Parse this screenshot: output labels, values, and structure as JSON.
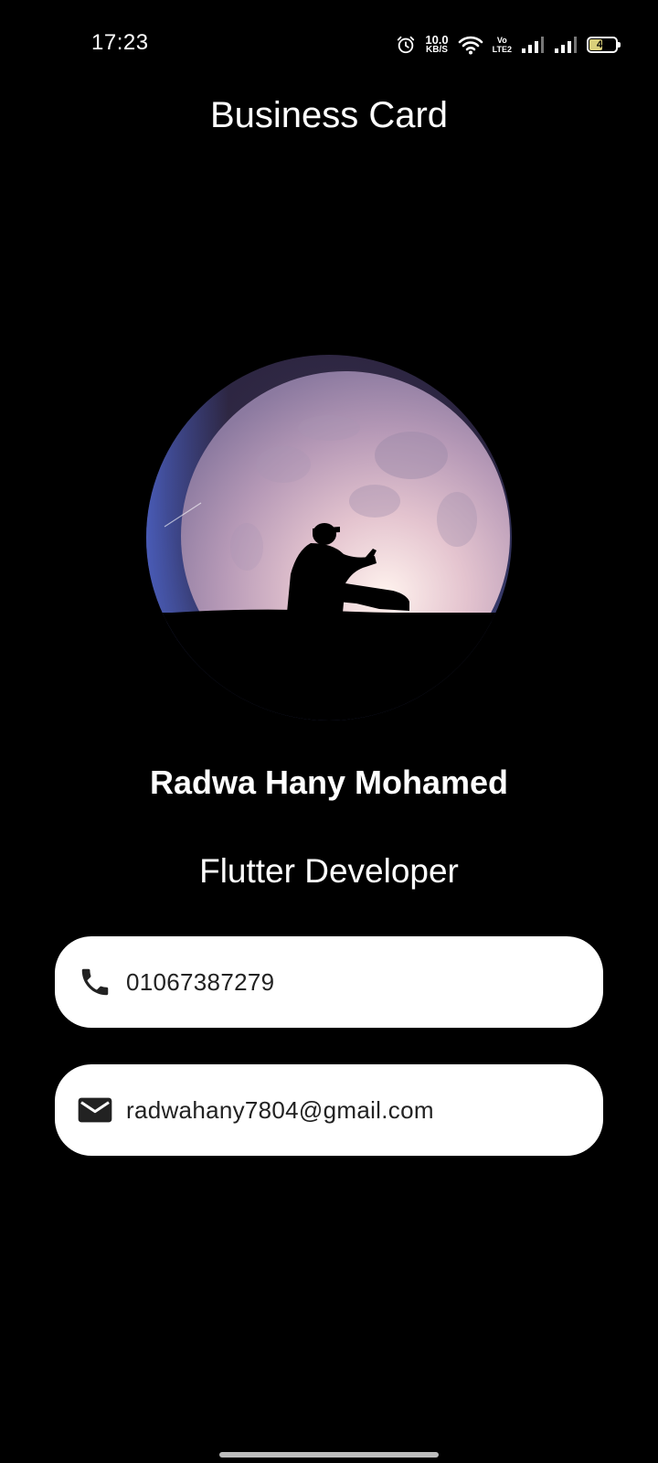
{
  "status_bar": {
    "time": "17:23",
    "net_speed_value": "10.0",
    "net_speed_unit": "KB/S",
    "volte_top": "Vo",
    "volte_bottom": "LTE2",
    "battery_level": "47",
    "icons": [
      "alarm-icon",
      "wifi-icon",
      "signal-icon",
      "signal-icon",
      "battery-icon"
    ]
  },
  "app_bar": {
    "title": "Business Card"
  },
  "profile": {
    "avatar_icon": "moon-silhouette-avatar",
    "name": "Radwa Hany Mohamed",
    "role": "Flutter Developer"
  },
  "contacts": {
    "phone": {
      "icon": "phone-icon",
      "value": "01067387279"
    },
    "email": {
      "icon": "mail-icon",
      "value": "radwahany7804@gmail.com"
    }
  },
  "colors": {
    "background": "#000000",
    "card": "#ffffff",
    "text_primary": "#ffffff",
    "card_text": "#222222"
  }
}
